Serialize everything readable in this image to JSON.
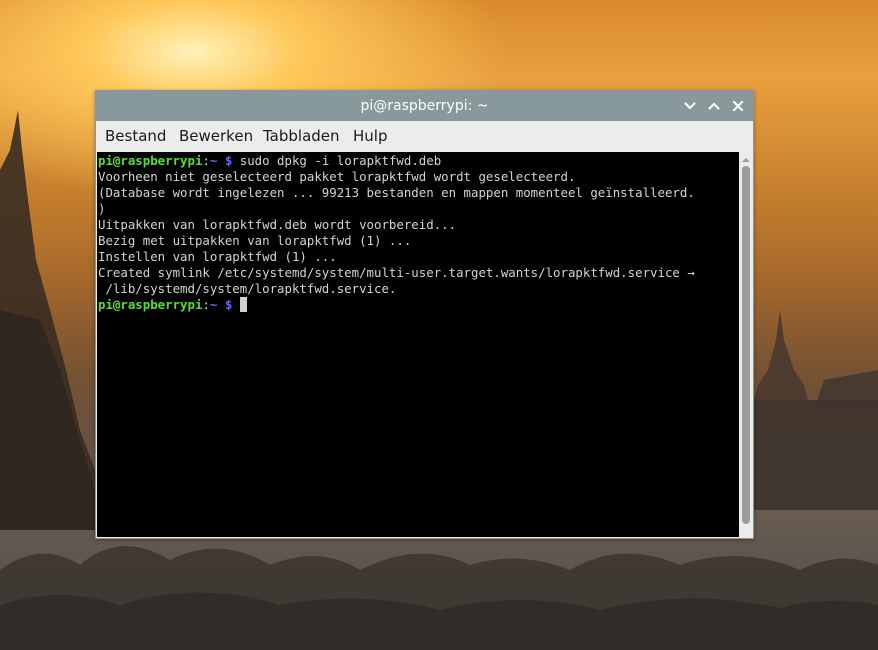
{
  "window": {
    "title": "pi@raspberrypi: ~"
  },
  "menubar": {
    "items": [
      {
        "label": "Bestand"
      },
      {
        "label": "Bewerken"
      },
      {
        "label": "Tabbladen"
      },
      {
        "label": "Hulp"
      }
    ]
  },
  "terminal": {
    "prompt": {
      "user_host": "pi@raspberrypi",
      "separator": ":",
      "path": "~",
      "dollar": " $"
    },
    "command": " sudo dpkg -i lorapktfwd.deb",
    "output": [
      "Voorheen niet geselecteerd pakket lorapktfwd wordt geselecteerd.",
      "(Database wordt ingelezen ... 99213 bestanden en mappen momenteel geïnstalleerd.",
      ")",
      "Uitpakken van lorapktfwd.deb wordt voorbereid...",
      "Bezig met uitpakken van lorapktfwd (1) ...",
      "Instellen van lorapktfwd (1) ...",
      "Created symlink /etc/systemd/system/multi-user.target.wants/lorapktfwd.service →",
      " /lib/systemd/system/lorapktfwd.service."
    ]
  },
  "colors": {
    "titlebar": "#87999a",
    "prompt_user": "#55e036",
    "prompt_path": "#5c6cff",
    "terminal_bg": "#000000",
    "terminal_fg": "#d4d4d4"
  },
  "icons": {
    "minimize": "chevron-down-icon",
    "maximize": "chevron-up-icon",
    "close": "close-icon"
  }
}
